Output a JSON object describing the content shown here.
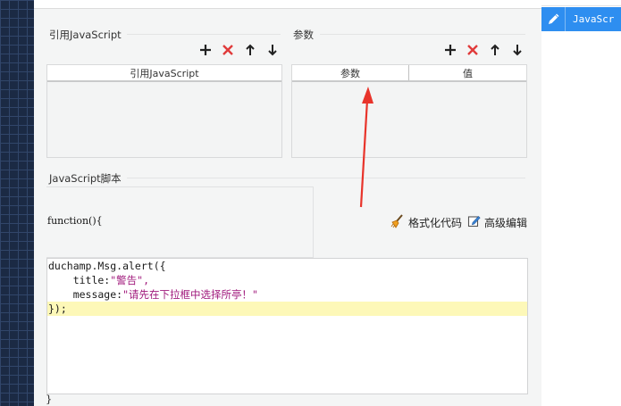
{
  "sections": {
    "refs_title": "引用JavaScript",
    "params_title": "参数",
    "script_title": "JavaScript脚本"
  },
  "refs_table": {
    "columns": [
      "引用JavaScript"
    ]
  },
  "params_table": {
    "columns": [
      "参数",
      "值"
    ]
  },
  "toolbar_icons": [
    "plus-icon",
    "delete-icon",
    "arrow-up-icon",
    "arrow-down-icon"
  ],
  "code": {
    "function_header": "function(){",
    "closing_brace": "}",
    "lines": [
      {
        "plain": "duchamp.Msg.alert({",
        "str": ""
      },
      {
        "plain": "    title:",
        "str": "\"警告\","
      },
      {
        "plain": "    message:",
        "str": "\"请先在下拉框中选择所亭！\""
      },
      {
        "plain": "});",
        "str": ""
      }
    ]
  },
  "actions": {
    "format_label": "格式化代码",
    "advanced_label": "高级编辑"
  },
  "right_panel": {
    "selected_label": "JavaScr"
  },
  "colors": {
    "accent": "#2e8ef0",
    "delete_red": "#e03b3b",
    "annotation_arrow": "#e8342b",
    "highlight_line": "#fdf8b8",
    "string_color": "#a01a7c"
  }
}
